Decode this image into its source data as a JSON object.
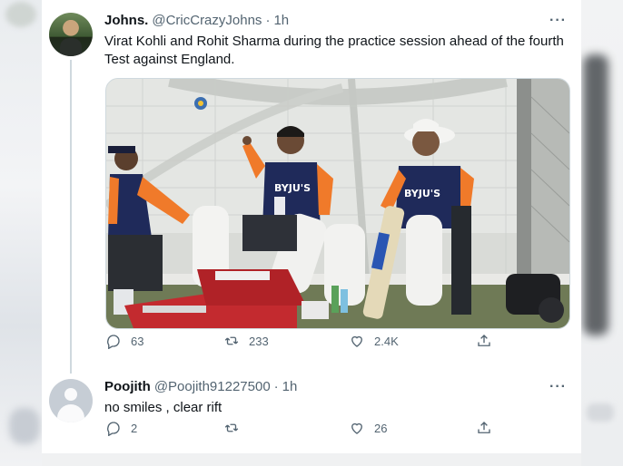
{
  "tweets": [
    {
      "name": "Johns.",
      "handle": "@CricCrazyJohns",
      "separator": "·",
      "time": "1h",
      "more": "···",
      "text": "Virat Kohli and Rohit Sharma during the practice session ahead of the fourth Test against England.",
      "replies": "63",
      "retweets": "233",
      "likes": "2.4K"
    },
    {
      "name": "Poojith",
      "handle": "@Poojith91227500",
      "separator": "·",
      "time": "1h",
      "more": "···",
      "text": "no smiles , clear rift",
      "replies": "2",
      "retweets": "",
      "likes": "26"
    }
  ],
  "photo": {
    "jersey_text_1": "BYJU'S",
    "jersey_text_2": "BYJU'S"
  },
  "colors": {
    "text_primary": "#0f1419",
    "text_secondary": "#536471",
    "border": "#cfd9de",
    "jersey_navy": "#1f2a5a",
    "jersey_orange": "#f07a2a"
  },
  "icons": [
    "reply-icon",
    "retweet-icon",
    "like-icon",
    "share-icon",
    "more-icon"
  ]
}
